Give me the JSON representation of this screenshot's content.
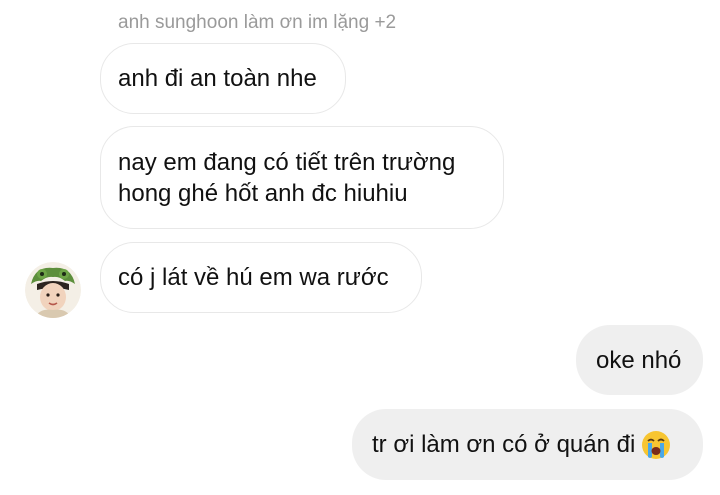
{
  "thread": {
    "sender_name": "anh sunghoon làm ơn im lặng +2",
    "messages": [
      {
        "direction": "incoming",
        "text": "anh đi an toàn nhe"
      },
      {
        "direction": "incoming",
        "lines": [
          "nay em đang có tiết trên trường",
          "hong ghé hốt anh đc hiuhiu"
        ]
      },
      {
        "direction": "incoming",
        "text": "có j lát về hú em wa rước"
      },
      {
        "direction": "outgoing",
        "text": "oke nhó"
      },
      {
        "direction": "outgoing",
        "text": "tr ơi làm ơn có ở quán đi",
        "emoji": "loudly-crying-face-icon"
      }
    ]
  },
  "colors": {
    "outgoing_bubble": "#efefef",
    "incoming_border": "#e8e8e8",
    "meta_text": "#9a9a9a"
  }
}
